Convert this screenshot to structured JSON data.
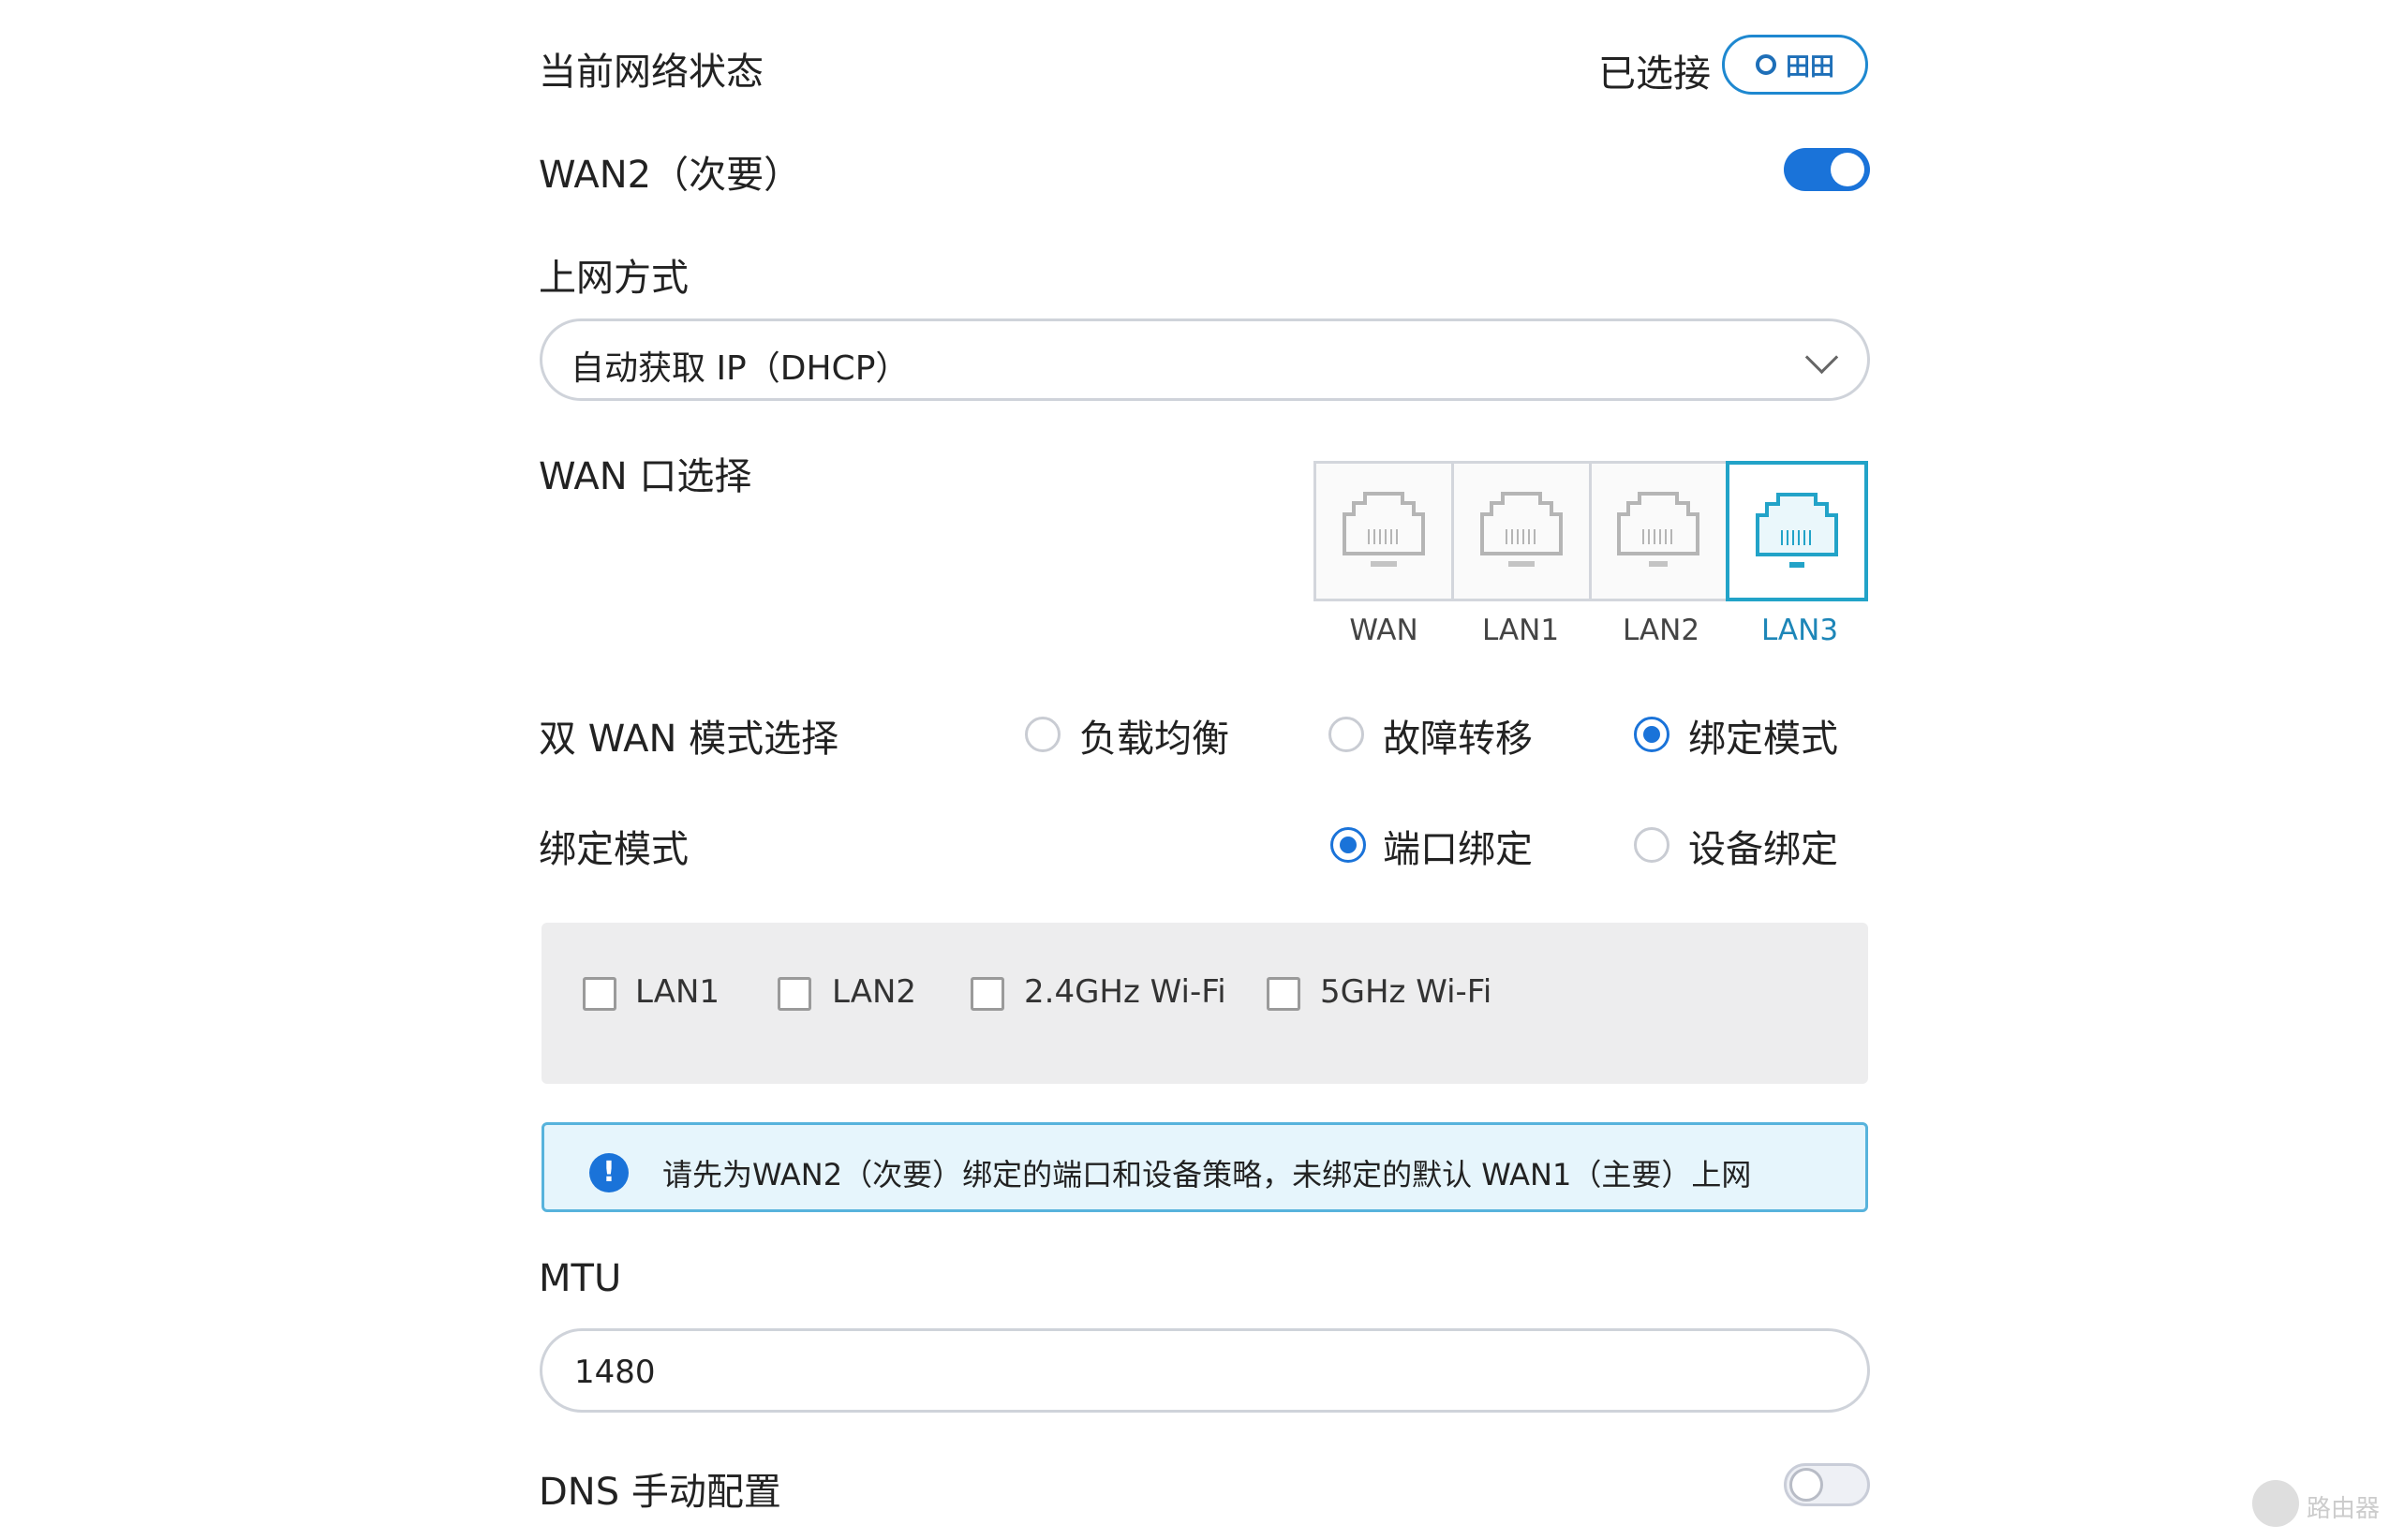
{
  "status": {
    "label": "当前网络状态",
    "state": "已选接",
    "badge": "田田"
  },
  "wan2": {
    "label": "WAN2（次要）",
    "enabled": true
  },
  "connection": {
    "label": "上网方式",
    "selected": "自动获取 IP（DHCP）"
  },
  "wan_port": {
    "label": "WAN 口选择",
    "ports": [
      {
        "name": "WAN",
        "selected": false
      },
      {
        "name": "LAN1",
        "selected": false
      },
      {
        "name": "LAN2",
        "selected": false
      },
      {
        "name": "LAN3",
        "selected": true
      }
    ]
  },
  "dual_wan": {
    "label": "双 WAN 模式选择",
    "options": [
      {
        "label": "负载均衡",
        "selected": false
      },
      {
        "label": "故障转移",
        "selected": false
      },
      {
        "label": "绑定模式",
        "selected": true
      }
    ]
  },
  "bind_mode": {
    "label": "绑定模式",
    "options": [
      {
        "label": "端口绑定",
        "selected": true
      },
      {
        "label": "设备绑定",
        "selected": false
      }
    ]
  },
  "bind_targets": [
    {
      "label": "LAN1",
      "checked": false
    },
    {
      "label": "LAN2",
      "checked": false
    },
    {
      "label": "2.4GHz Wi-Fi",
      "checked": false
    },
    {
      "label": "5GHz Wi-Fi",
      "checked": false
    }
  ],
  "notice": {
    "text": "请先为WAN2（次要）绑定的端口和设备策略，未绑定的默认 WAN1（主要）上网"
  },
  "mtu": {
    "label": "MTU",
    "value": "1480"
  },
  "dns": {
    "label": "DNS 手动配置",
    "enabled": false
  },
  "watermark": {
    "text": "路由器"
  },
  "colors": {
    "accent": "#1a73d9",
    "port_selected": "#22a3c8",
    "notice_bg": "#e6f5fc"
  }
}
